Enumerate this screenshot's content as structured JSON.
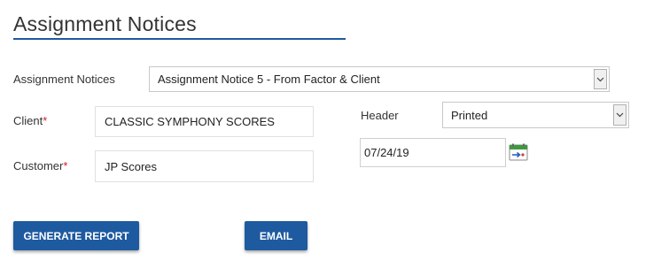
{
  "page": {
    "title": "Assignment Notices"
  },
  "form": {
    "assignment_notices": {
      "label": "Assignment Notices",
      "selected": "Assignment Notice 5 - From Factor & Client"
    },
    "client": {
      "label": "Client",
      "required_mark": "*",
      "value": "CLASSIC SYMPHONY SCORES"
    },
    "customer": {
      "label": "Customer",
      "required_mark": "*",
      "value": "JP Scores"
    },
    "header": {
      "label": "Header",
      "selected": "Printed"
    },
    "date": {
      "value": "07/24/19"
    }
  },
  "buttons": {
    "generate_report": "GENERATE REPORT",
    "email": "EMAIL"
  },
  "icons": {
    "dropdown": "chevron-down-icon",
    "calendar": "calendar-icon"
  },
  "colors": {
    "accent": "#1e5aa0",
    "required": "#cc2222"
  }
}
